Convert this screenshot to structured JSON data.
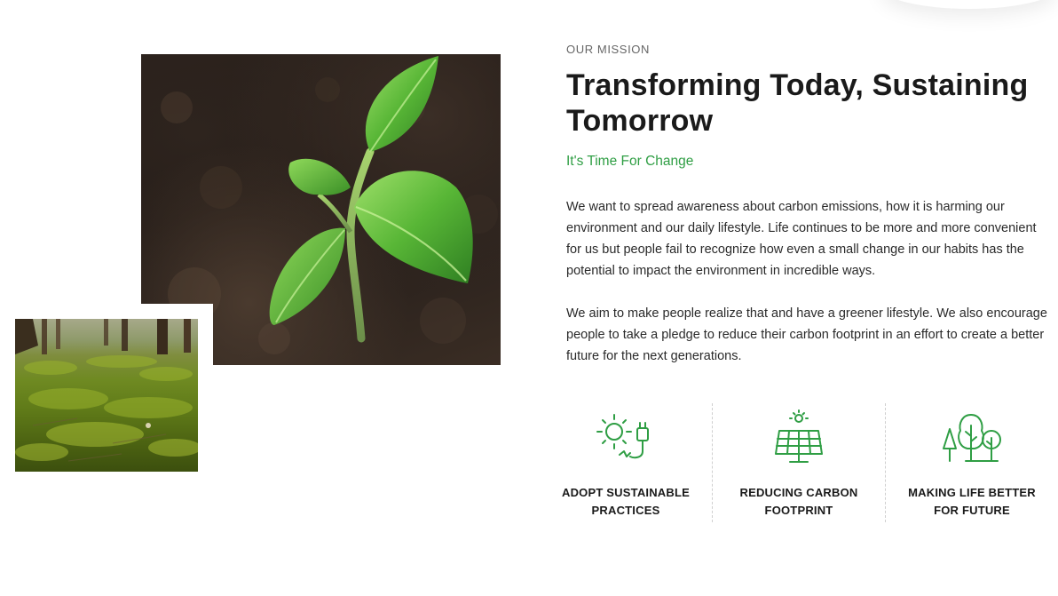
{
  "mission": {
    "eyebrow": "OUR MISSION",
    "title": "Transforming Today, Sustaining Tomorrow",
    "tagline": "It's Time For Change",
    "paragraphs": [
      "We want to spread awareness about carbon emissions, how it is harming our environment and our daily lifestyle. Life continues to be more and more convenient for us but people fail to recognize how even a small change in our habits has the potential to impact the environment in incredible ways.",
      "We aim to make people realize that and have a greener lifestyle. We also encourage people to take a pledge to reduce their carbon footprint in an effort to create a better future for the next generations."
    ]
  },
  "features": [
    {
      "label": "ADOPT SUSTAINABLE PRACTICES",
      "icon": "sun-plug-icon"
    },
    {
      "label": "REDUCING CARBON FOOTPRINT",
      "icon": "solar-panel-icon"
    },
    {
      "label": "MAKING LIFE BETTER FOR FUTURE",
      "icon": "trees-icon"
    }
  ],
  "images": {
    "main": "seedling-photo",
    "secondary": "forest-moss-photo"
  },
  "colors": {
    "accent": "#2f9e44",
    "heading": "#1a1a1a",
    "text": "#2a2a2a",
    "muted": "#666666"
  }
}
